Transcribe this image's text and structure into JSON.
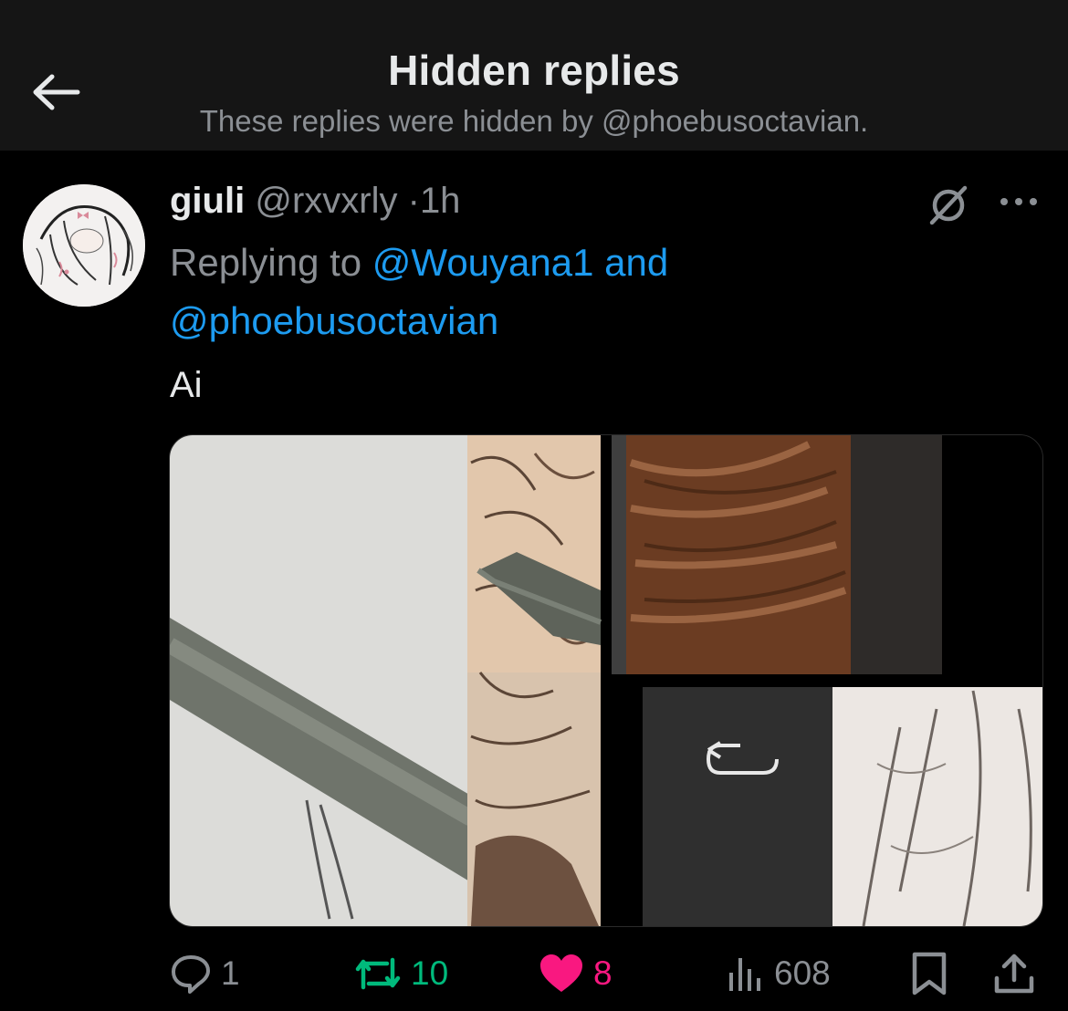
{
  "header": {
    "title": "Hidden replies",
    "subtitle": "These replies were hidden by @phoebusoctavian."
  },
  "post": {
    "display_name": "giuli",
    "handle": "@rxvxrly",
    "separator": "·",
    "time": "1h",
    "replying_prefix": "Replying to",
    "reply_to_1": "@Wouyana1",
    "reply_joiner": "and",
    "reply_to_2": "@phoebusoctavian",
    "text": "Ai"
  },
  "actions": {
    "replies": "1",
    "reposts": "10",
    "likes": "8",
    "views": "608"
  },
  "icons": {
    "back": "arrow-left-icon",
    "hide": "hidden-reply-icon",
    "more": "more-icon",
    "reply": "reply-icon",
    "repost": "repost-icon",
    "like": "heart-icon",
    "views": "views-icon",
    "bookmark": "bookmark-icon",
    "share": "share-icon"
  },
  "colors": {
    "link": "#1d9bf0",
    "repost": "#00ba7c",
    "like": "#f91880",
    "muted": "#8b8f94",
    "text": "#e7e9ea"
  }
}
